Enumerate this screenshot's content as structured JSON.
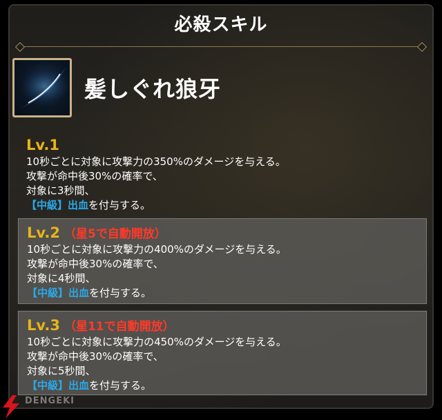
{
  "header": {
    "title": "必殺スキル"
  },
  "skill": {
    "icon": "blue-slash-icon",
    "name": "髪しぐれ狼牙"
  },
  "levels": [
    {
      "label": "Lv.1",
      "note": "",
      "line1": "10秒ごとに対象に攻撃力の350%のダメージを与える。",
      "line2": "攻撃が命中後30%の確率で、",
      "line3": "対象に3秒間、",
      "kw1": "【中級】",
      "kw2": "出血",
      "tail": "を付与する。"
    },
    {
      "label": "Lv.2",
      "note": "（星5で自動開放）",
      "line1": "10秒ごとに対象に攻撃力の400%のダメージを与える。",
      "line2": "攻撃が命中後30%の確率で、",
      "line3": "対象に4秒間、",
      "kw1": "【中級】",
      "kw2": "出血",
      "tail": "を付与する。"
    },
    {
      "label": "Lv.3",
      "note": "（星11で自動開放）",
      "line1": "10秒ごとに対象に攻撃力の450%のダメージを与える。",
      "line2": "攻撃が命中後30%の確率で、",
      "line3": "対象に5秒間、",
      "kw1": "【中級】",
      "kw2": "出血",
      "tail": "を付与する。"
    }
  ],
  "watermark": {
    "text": "DENGEKI"
  },
  "colors": {
    "level_label": "#e8b41a",
    "unlock_note": "#ff3a2a",
    "keyword": "#29a9ea"
  }
}
